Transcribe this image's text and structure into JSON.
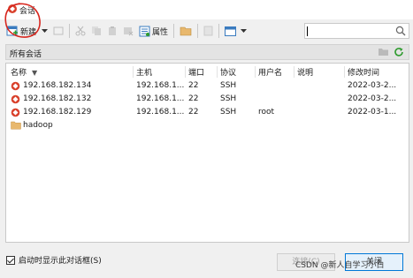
{
  "window": {
    "title": "会话"
  },
  "toolbar": {
    "new_label": "新建",
    "properties_label": "属性"
  },
  "pathbar": {
    "label": "所有会话"
  },
  "columns": [
    "名称",
    "主机",
    "端口",
    "协议",
    "用户名",
    "说明",
    "修改时间"
  ],
  "sessions": [
    {
      "name": "192.168.182.134",
      "host": "192.168.1...",
      "port": "22",
      "protocol": "SSH",
      "user": "",
      "note": "",
      "modified": "2022-03-2..."
    },
    {
      "name": "192.168.182.132",
      "host": "192.168.1...",
      "port": "22",
      "protocol": "SSH",
      "user": "",
      "note": "",
      "modified": "2022-03-2..."
    },
    {
      "name": "192.168.182.129",
      "host": "192.168.1...",
      "port": "22",
      "protocol": "SSH",
      "user": "root",
      "note": "",
      "modified": "2022-03-1..."
    }
  ],
  "folders": [
    {
      "name": "hadoop"
    }
  ],
  "footer": {
    "startup_checkbox_label": "启动时显示此对话框(S)",
    "startup_checked": true,
    "connect_label": "连接(C)",
    "close_label": "关闭"
  },
  "watermark": "CSDN @新人自学习小白",
  "colors": {
    "accent": "#0078d7",
    "annotation": "#d7261e",
    "folder": "#e8b86d"
  },
  "icons": [
    "app-icon",
    "new-session-icon",
    "cut-icon",
    "copy-icon",
    "paste-icon",
    "delete-icon",
    "properties-icon",
    "folder-icon",
    "view-icon",
    "search-icon",
    "refresh-icon",
    "session-icon"
  ]
}
